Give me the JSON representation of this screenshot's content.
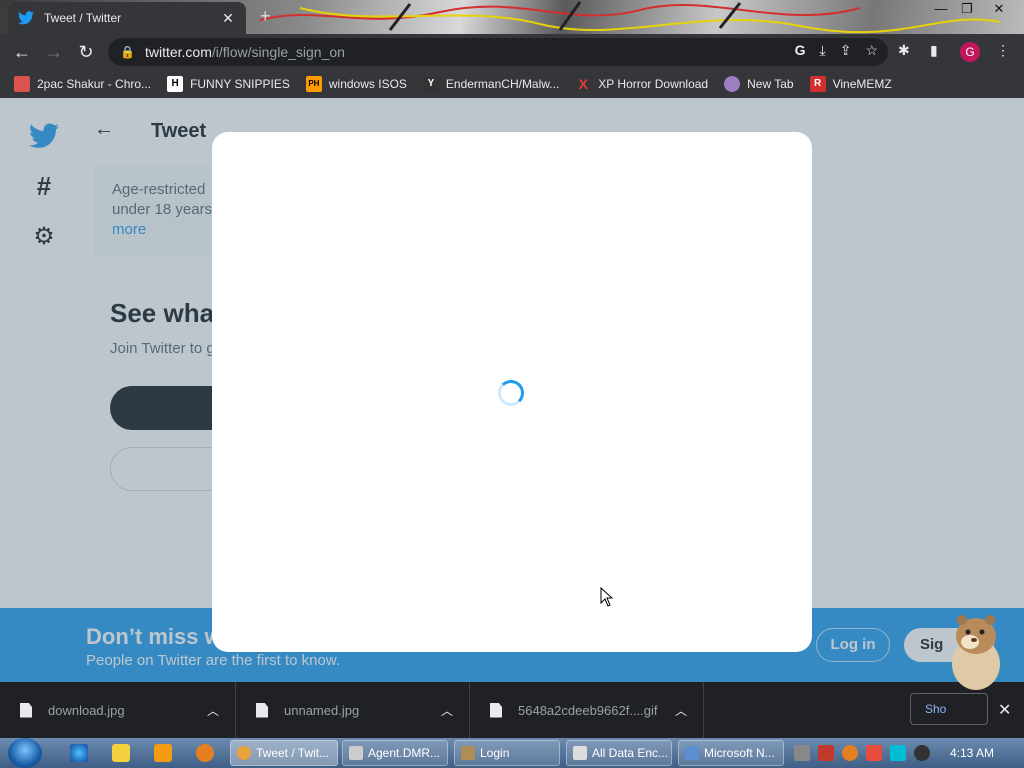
{
  "browser": {
    "tab_title": "Tweet / Twitter",
    "tab_close": "✕",
    "new_tab": "+",
    "url_host": "twitter.com",
    "url_path": "/i/flow/single_sign_on",
    "profile_initial": "G"
  },
  "bookmarks": [
    {
      "label": "2pac Shakur - Chro...",
      "icon_text": "",
      "color": "#d9534f"
    },
    {
      "label": "FUNNY SNIPPIES",
      "icon_text": "H",
      "color": "#ffffff"
    },
    {
      "label": "windows ISOS",
      "icon_text": "PH",
      "color": "#ff9900"
    },
    {
      "label": "EndermanCH/Malw...",
      "icon_text": "Y",
      "color": "#333333"
    },
    {
      "label": "XP Horror Download",
      "icon_text": "X",
      "color": "#e53935"
    },
    {
      "label": "New Tab",
      "icon_text": "",
      "color": "#9c7fbf"
    },
    {
      "label": "VineMEMZ",
      "icon_text": "R",
      "color": "#d32f2f"
    }
  ],
  "twitter": {
    "back_arrow": "←",
    "heading": "Tweet",
    "age_text": "Age-restricted",
    "age_text2": "under 18 years",
    "age_more": "more",
    "see_what": "See wha",
    "join_text": "Join Twitter to g",
    "banner_title": "Don’t miss w",
    "banner_sub": "People on Twitter are the first to know.",
    "login_label": "Log in",
    "signup_label": "Sig"
  },
  "downloads": {
    "items": [
      {
        "name": "download.jpg"
      },
      {
        "name": "unnamed.jpg"
      },
      {
        "name": "5648a2cdeeb9662f....gif"
      }
    ],
    "show_all": "Sho",
    "close": "✕"
  },
  "taskbar": {
    "tasks": [
      {
        "label": "Tweet / Twit...",
        "color": "#e8a33a"
      },
      {
        "label": "Agent.DMR...",
        "color": "#cccccc"
      },
      {
        "label": "Login",
        "color": "#b08d57"
      },
      {
        "label": "All Data Enc...",
        "color": "#dddddd"
      },
      {
        "label": "Microsoft N...",
        "color": "#5b8fd1"
      }
    ],
    "clock": "4:13 AM"
  },
  "colors": {
    "twitter_blue": "#1d9bf0",
    "chrome_dark": "#35363a"
  }
}
